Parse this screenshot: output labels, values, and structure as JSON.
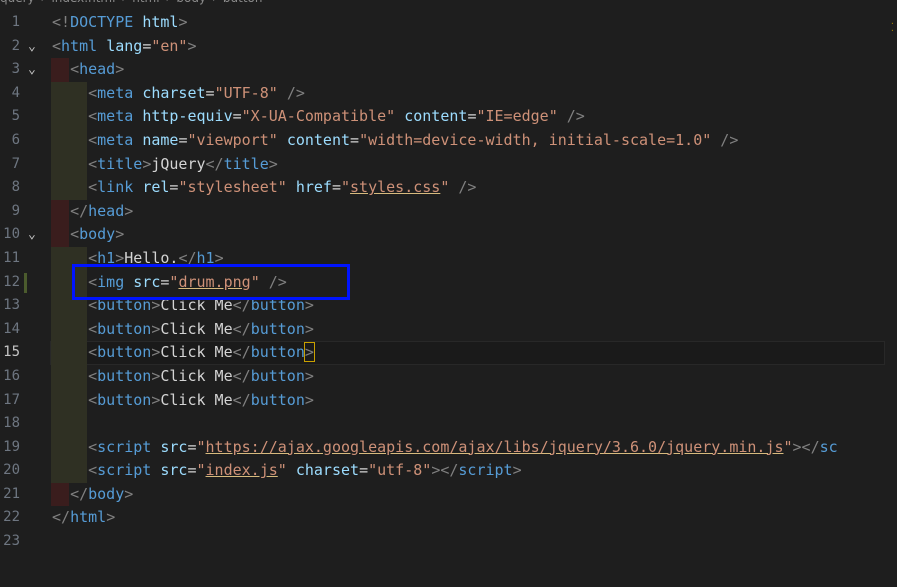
{
  "breadcrumb": {
    "items": [
      "query",
      "index.html",
      "html",
      "body",
      "button"
    ]
  },
  "editor": {
    "lines": [
      {
        "n": "1",
        "tokens": [
          [
            "p",
            "<!"
          ],
          [
            "t",
            "DOCTYPE"
          ],
          [
            "txt",
            " "
          ],
          [
            "a",
            "html"
          ],
          [
            "p",
            ">"
          ]
        ]
      },
      {
        "n": "2",
        "tokens": [
          [
            "p",
            "<"
          ],
          [
            "t",
            "html"
          ],
          [
            "txt",
            " "
          ],
          [
            "a",
            "lang"
          ],
          [
            "txt",
            "="
          ],
          [
            "s",
            "\"en\""
          ],
          [
            "p",
            ">"
          ]
        ]
      },
      {
        "n": "3",
        "tokens": [
          [
            "txt",
            "  "
          ],
          [
            "p",
            "<"
          ],
          [
            "t",
            "head"
          ],
          [
            "p",
            ">"
          ]
        ]
      },
      {
        "n": "4",
        "tokens": [
          [
            "txt",
            "    "
          ],
          [
            "p",
            "<"
          ],
          [
            "t",
            "meta"
          ],
          [
            "txt",
            " "
          ],
          [
            "a",
            "charset"
          ],
          [
            "txt",
            "="
          ],
          [
            "s",
            "\"UTF-8\""
          ],
          [
            "txt",
            " "
          ],
          [
            "p",
            "/>"
          ]
        ]
      },
      {
        "n": "5",
        "tokens": [
          [
            "txt",
            "    "
          ],
          [
            "p",
            "<"
          ],
          [
            "t",
            "meta"
          ],
          [
            "txt",
            " "
          ],
          [
            "a",
            "http-equiv"
          ],
          [
            "txt",
            "="
          ],
          [
            "s",
            "\"X-UA-Compatible\""
          ],
          [
            "txt",
            " "
          ],
          [
            "a",
            "content"
          ],
          [
            "txt",
            "="
          ],
          [
            "s",
            "\"IE=edge\""
          ],
          [
            "txt",
            " "
          ],
          [
            "p",
            "/>"
          ]
        ]
      },
      {
        "n": "6",
        "tokens": [
          [
            "txt",
            "    "
          ],
          [
            "p",
            "<"
          ],
          [
            "t",
            "meta"
          ],
          [
            "txt",
            " "
          ],
          [
            "a",
            "name"
          ],
          [
            "txt",
            "="
          ],
          [
            "s",
            "\"viewport\""
          ],
          [
            "txt",
            " "
          ],
          [
            "a",
            "content"
          ],
          [
            "txt",
            "="
          ],
          [
            "s",
            "\"width=device-width, initial-scale=1.0\""
          ],
          [
            "txt",
            " "
          ],
          [
            "p",
            "/>"
          ]
        ]
      },
      {
        "n": "7",
        "tokens": [
          [
            "txt",
            "    "
          ],
          [
            "p",
            "<"
          ],
          [
            "t",
            "title"
          ],
          [
            "p",
            ">"
          ],
          [
            "txt",
            "jQuery"
          ],
          [
            "p",
            "</"
          ],
          [
            "t",
            "title"
          ],
          [
            "p",
            ">"
          ]
        ]
      },
      {
        "n": "8",
        "tokens": [
          [
            "txt",
            "    "
          ],
          [
            "p",
            "<"
          ],
          [
            "t",
            "link"
          ],
          [
            "txt",
            " "
          ],
          [
            "a",
            "rel"
          ],
          [
            "txt",
            "="
          ],
          [
            "s",
            "\"stylesheet\""
          ],
          [
            "txt",
            " "
          ],
          [
            "a",
            "href"
          ],
          [
            "txt",
            "="
          ],
          [
            "s",
            "\""
          ],
          [
            "su",
            "styles.css"
          ],
          [
            "s",
            "\""
          ],
          [
            "txt",
            " "
          ],
          [
            "p",
            "/>"
          ]
        ]
      },
      {
        "n": "9",
        "tokens": [
          [
            "txt",
            "  "
          ],
          [
            "p",
            "</"
          ],
          [
            "t",
            "head"
          ],
          [
            "p",
            ">"
          ]
        ]
      },
      {
        "n": "10",
        "tokens": [
          [
            "txt",
            "  "
          ],
          [
            "p",
            "<"
          ],
          [
            "t",
            "body"
          ],
          [
            "p",
            ">"
          ]
        ]
      },
      {
        "n": "11",
        "tokens": [
          [
            "txt",
            "    "
          ],
          [
            "p",
            "<"
          ],
          [
            "t",
            "h1"
          ],
          [
            "p",
            ">"
          ],
          [
            "txt",
            "Hello."
          ],
          [
            "p",
            "</"
          ],
          [
            "t",
            "h1"
          ],
          [
            "p",
            ">"
          ]
        ]
      },
      {
        "n": "12",
        "tokens": [
          [
            "txt",
            "    "
          ],
          [
            "p",
            "<"
          ],
          [
            "t",
            "img"
          ],
          [
            "txt",
            " "
          ],
          [
            "a",
            "src"
          ],
          [
            "txt",
            "="
          ],
          [
            "s",
            "\""
          ],
          [
            "su",
            "drum.png"
          ],
          [
            "s",
            "\""
          ],
          [
            "txt",
            " "
          ],
          [
            "p",
            "/>"
          ]
        ]
      },
      {
        "n": "13",
        "tokens": [
          [
            "txt",
            "    "
          ],
          [
            "p",
            "<"
          ],
          [
            "t",
            "button"
          ],
          [
            "p",
            ">"
          ],
          [
            "txt",
            "Click Me"
          ],
          [
            "p",
            "</"
          ],
          [
            "t",
            "button"
          ],
          [
            "p",
            ">"
          ]
        ]
      },
      {
        "n": "14",
        "tokens": [
          [
            "txt",
            "    "
          ],
          [
            "p",
            "<"
          ],
          [
            "t",
            "button"
          ],
          [
            "p",
            ">"
          ],
          [
            "txt",
            "Click Me"
          ],
          [
            "p",
            "</"
          ],
          [
            "t",
            "button"
          ],
          [
            "p",
            ">"
          ]
        ]
      },
      {
        "n": "15",
        "tokens": [
          [
            "txt",
            "    "
          ],
          [
            "p",
            "<"
          ],
          [
            "t",
            "button"
          ],
          [
            "p",
            ">"
          ],
          [
            "txt",
            "Click Me"
          ],
          [
            "p",
            "</"
          ],
          [
            "t",
            "button"
          ],
          [
            "pm",
            ">"
          ]
        ]
      },
      {
        "n": "16",
        "tokens": [
          [
            "txt",
            "    "
          ],
          [
            "p",
            "<"
          ],
          [
            "t",
            "button"
          ],
          [
            "p",
            ">"
          ],
          [
            "txt",
            "Click Me"
          ],
          [
            "p",
            "</"
          ],
          [
            "t",
            "button"
          ],
          [
            "p",
            ">"
          ]
        ]
      },
      {
        "n": "17",
        "tokens": [
          [
            "txt",
            "    "
          ],
          [
            "p",
            "<"
          ],
          [
            "t",
            "button"
          ],
          [
            "p",
            ">"
          ],
          [
            "txt",
            "Click Me"
          ],
          [
            "p",
            "</"
          ],
          [
            "t",
            "button"
          ],
          [
            "p",
            ">"
          ]
        ]
      },
      {
        "n": "18",
        "tokens": []
      },
      {
        "n": "19",
        "tokens": [
          [
            "txt",
            "    "
          ],
          [
            "p",
            "<"
          ],
          [
            "t",
            "script"
          ],
          [
            "txt",
            " "
          ],
          [
            "a",
            "src"
          ],
          [
            "txt",
            "="
          ],
          [
            "s",
            "\""
          ],
          [
            "su",
            "https://ajax.googleapis.com/ajax/libs/jquery/3.6.0/jquery.min.js"
          ],
          [
            "s",
            "\""
          ],
          [
            "p",
            "></"
          ],
          [
            "t",
            "sc"
          ]
        ]
      },
      {
        "n": "20",
        "tokens": [
          [
            "txt",
            "    "
          ],
          [
            "p",
            "<"
          ],
          [
            "t",
            "script"
          ],
          [
            "txt",
            " "
          ],
          [
            "a",
            "src"
          ],
          [
            "txt",
            "="
          ],
          [
            "s",
            "\""
          ],
          [
            "su",
            "index.js"
          ],
          [
            "s",
            "\""
          ],
          [
            "txt",
            " "
          ],
          [
            "a",
            "charset"
          ],
          [
            "txt",
            "="
          ],
          [
            "s",
            "\"utf-8\""
          ],
          [
            "p",
            "></"
          ],
          [
            "t",
            "script"
          ],
          [
            "p",
            ">"
          ]
        ]
      },
      {
        "n": "21",
        "tokens": [
          [
            "txt",
            "  "
          ],
          [
            "p",
            "</"
          ],
          [
            "t",
            "body"
          ],
          [
            "p",
            ">"
          ]
        ]
      },
      {
        "n": "22",
        "tokens": [
          [
            "p",
            "</"
          ],
          [
            "t",
            "html"
          ],
          [
            "p",
            ">"
          ]
        ]
      },
      {
        "n": "23",
        "tokens": []
      }
    ],
    "folds": {
      "2": "⌄",
      "3": "⌄",
      "10": "⌄"
    },
    "current_line": "15",
    "modified_line": "12"
  }
}
